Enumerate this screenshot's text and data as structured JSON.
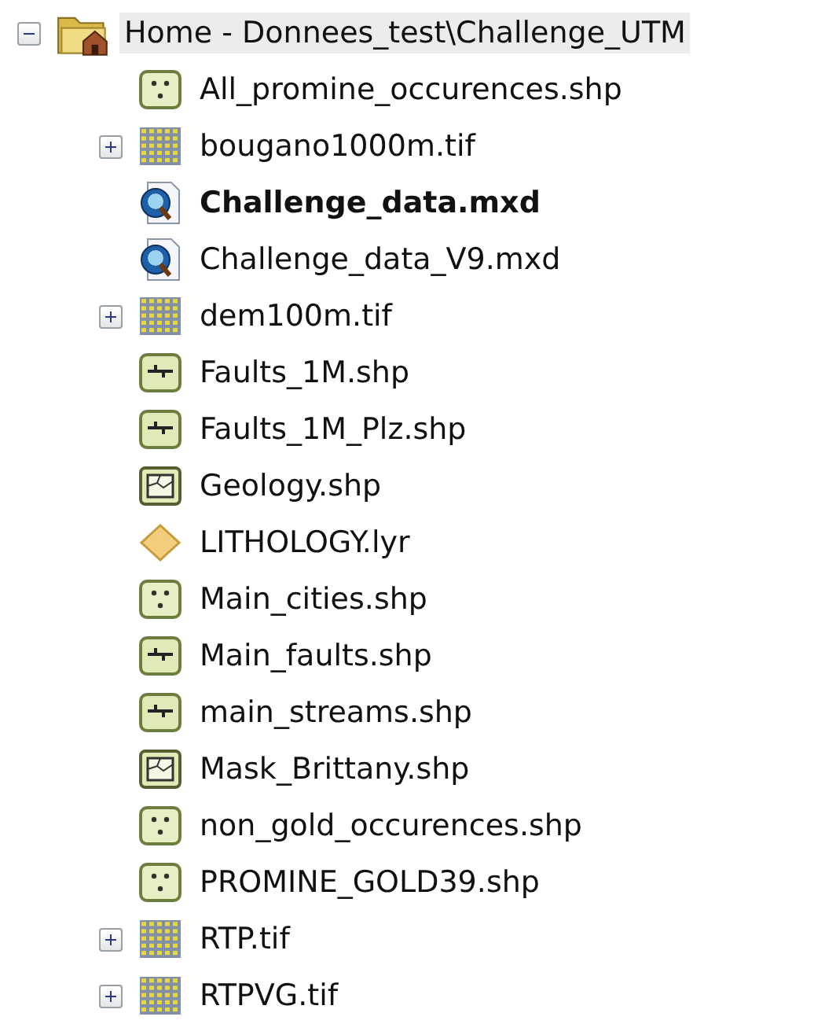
{
  "tree": {
    "label": "Home - Donnees_test\\Challenge_UTM",
    "kind": "home-folder",
    "expanded": true,
    "selected": true,
    "children": [
      {
        "label": "All_promine_occurences.shp",
        "kind": "point",
        "current": false
      },
      {
        "label": "bougano1000m.tif",
        "kind": "raster",
        "expanded": false,
        "current": false
      },
      {
        "label": "Challenge_data.mxd",
        "kind": "map",
        "current": true
      },
      {
        "label": "Challenge_data_V9.mxd",
        "kind": "map",
        "current": false
      },
      {
        "label": "dem100m.tif",
        "kind": "raster",
        "expanded": false,
        "current": false
      },
      {
        "label": "Faults_1M.shp",
        "kind": "line",
        "current": false
      },
      {
        "label": "Faults_1M_Plz.shp",
        "kind": "line",
        "current": false
      },
      {
        "label": "Geology.shp",
        "kind": "polygon",
        "current": false
      },
      {
        "label": "LITHOLOGY.lyr",
        "kind": "layer",
        "current": false
      },
      {
        "label": "Main_cities.shp",
        "kind": "point",
        "current": false
      },
      {
        "label": "Main_faults.shp",
        "kind": "line",
        "current": false
      },
      {
        "label": "main_streams.shp",
        "kind": "line",
        "current": false
      },
      {
        "label": "Mask_Brittany.shp",
        "kind": "polygon",
        "current": false
      },
      {
        "label": "non_gold_occurences.shp",
        "kind": "point",
        "current": false
      },
      {
        "label": "PROMINE_GOLD39.shp",
        "kind": "point",
        "current": false
      },
      {
        "label": "RTP.tif",
        "kind": "raster",
        "expanded": false,
        "current": false
      },
      {
        "label": "RTPVG.tif",
        "kind": "raster",
        "expanded": false,
        "current": false
      }
    ]
  }
}
